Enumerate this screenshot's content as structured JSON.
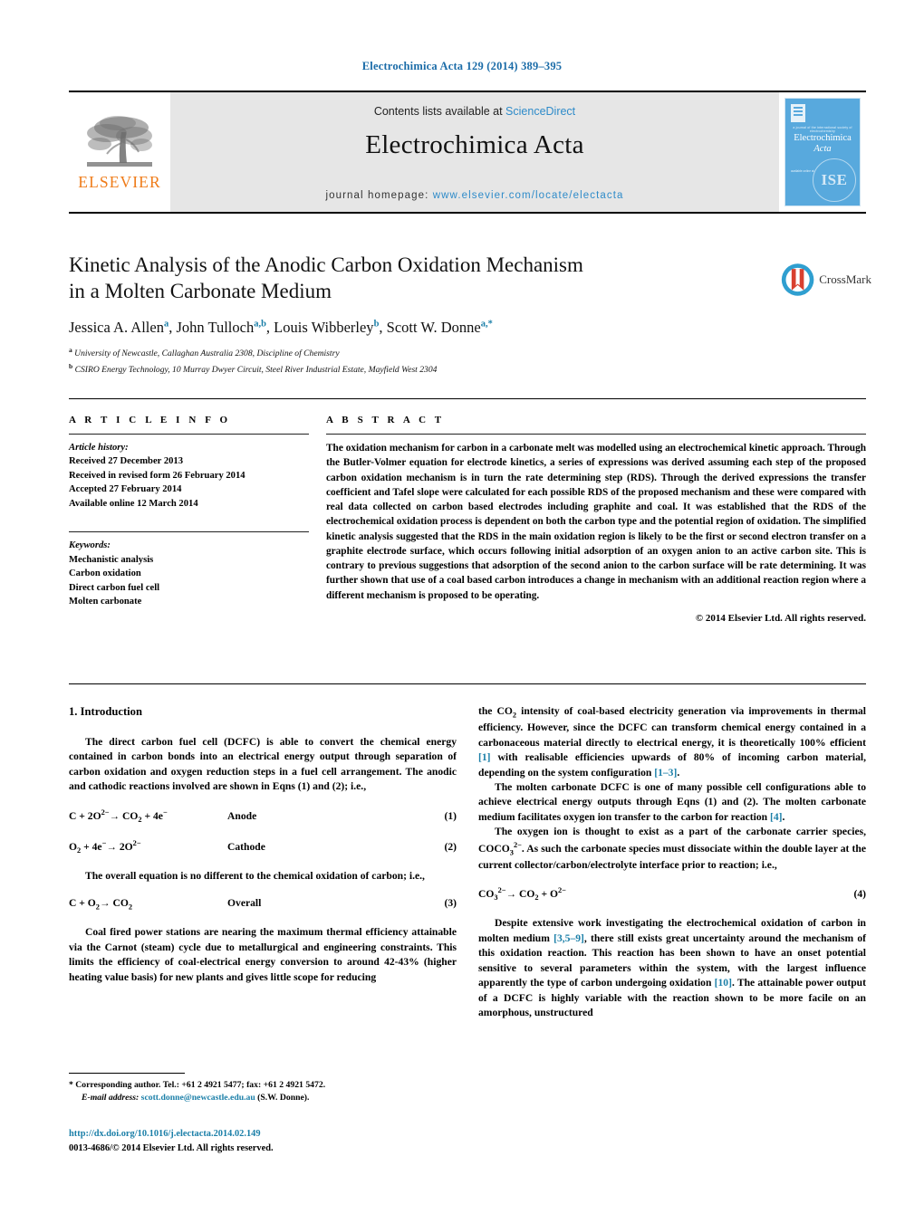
{
  "running_head": "Electrochimica Acta 129 (2014) 389–395",
  "masthead": {
    "contents_prefix": "Contents lists available at ",
    "sciencedirect": "ScienceDirect",
    "journal_name": "Electrochimica Acta",
    "homepage_prefix": "journal homepage: ",
    "homepage_url": "www.elsevier.com/locate/electacta",
    "publisher_logo_text": "ELSEVIER",
    "cover": {
      "title_line1": "Electrochimica",
      "title_line2": "Acta",
      "tagline": "a journal of the international society of electrochemistry",
      "sub_label": "available online at",
      "society_mark": "ISE"
    },
    "accent_color": "#2e8bc9",
    "elsevier_orange": "#ef7c1a"
  },
  "article": {
    "title_line1": "Kinetic Analysis of the Anodic Carbon Oxidation Mechanism",
    "title_line2": "in a Molten Carbonate Medium",
    "authors_html": "Jessica A. Allen<sup>a</sup>, John Tulloch<sup>a,b</sup>, Louis Wibberley<sup>b</sup>, Scott W. Donne<sup>a,*</sup>",
    "affiliation_a_marker": "a",
    "affiliation_a": "University of Newcastle, Callaghan Australia 2308, Discipline of Chemistry",
    "affiliation_b_marker": "b",
    "affiliation_b": "CSIRO Energy Technology, 10 Murray Dwyer Circuit, Steel River Industrial Estate, Mayfield West 2304",
    "crossmark_label": "CrossMark"
  },
  "article_info": {
    "heading": "A R T I C L E   I N F O",
    "history_label": "Article history:",
    "history": [
      "Received 27 December 2013",
      "Received in revised form 26 February 2014",
      "Accepted 27 February 2014",
      "Available online 12 March 2014"
    ],
    "keywords_label": "Keywords:",
    "keywords": [
      "Mechanistic analysis",
      "Carbon oxidation",
      "Direct carbon fuel cell",
      "Molten carbonate"
    ]
  },
  "abstract": {
    "heading": "A B S T R A C T",
    "text": "The oxidation mechanism for carbon in a carbonate melt was modelled using an electrochemical kinetic approach. Through the Butler-Volmer equation for electrode kinetics, a series of expressions was derived assuming each step of the proposed carbon oxidation mechanism is in turn the rate determining step (RDS). Through the derived expressions the transfer coefficient and Tafel slope were calculated for each possible RDS of the proposed mechanism and these were compared with real data collected on carbon based electrodes including graphite and coal. It was established that the RDS of the electrochemical oxidation process is dependent on both the carbon type and the potential region of oxidation. The simplified kinetic analysis suggested that the RDS in the main oxidation region is likely to be the first or second electron transfer on a graphite electrode surface, which occurs following initial adsorption of an oxygen anion to an active carbon site. This is contrary to previous suggestions that adsorption of the second anion to the carbon surface will be rate determining. It was further shown that use of a coal based carbon introduces a change in mechanism with an additional reaction region where a different mechanism is proposed to be operating.",
    "copyright": "© 2014 Elsevier Ltd. All rights reserved."
  },
  "body": {
    "section_heading": "1.  Introduction",
    "left": {
      "p1": "The direct carbon fuel cell (DCFC) is able to convert the chemical energy contained in carbon bonds into an electrical energy output through separation of carbon oxidation and oxygen reduction steps in a fuel cell arrangement. The anodic and cathodic reactions involved are shown in Eqns (1) and (2); i.e.,",
      "eq1_lhs": "C + 2O2− → CO2 + 4e−",
      "eq1_tag": "Anode",
      "eq1_num": "(1)",
      "eq2_lhs": "O2 + 4e− → 2O2−",
      "eq2_tag": "Cathode",
      "eq2_num": "(2)",
      "p2": "The overall equation is no different to the chemical oxidation of carbon; i.e.,",
      "eq3_lhs": "C + O2 → CO2",
      "eq3_tag": "Overall",
      "eq3_num": "(3)",
      "p3": "Coal fired power stations are nearing the maximum thermal efficiency attainable via the Carnot (steam) cycle due to metallurgical and engineering constraints. This limits the efficiency of coal-electrical energy conversion to around 42-43% (higher heating value basis) for new plants and gives little scope for reducing"
    },
    "right": {
      "p1a": "the CO",
      "p1b": " intensity of coal-based electricity generation via improvements in thermal efficiency. However, since the DCFC can transform chemical energy contained in a carbonaceous material directly to electrical energy, it is theoretically 100% efficient ",
      "p1_ref1": "[1]",
      "p1c": " with realisable efficiencies upwards of 80% of incoming carbon material, depending on the system configuration ",
      "p1_ref2": "[1–3]",
      "p1d": ".",
      "p2a": "The molten carbonate DCFC is one of many possible cell configurations able to achieve electrical energy outputs through Eqns (1) and (2). The molten carbonate medium facilitates oxygen ion transfer to the carbon for reaction ",
      "p2_ref": "[4]",
      "p2b": ".",
      "p3a": "The oxygen ion is thought to exist as a part of the carbonate carrier species, CO",
      "p3b": ". As such the carbonate species must dissociate within the double layer at the current collector/carbon/electrolyte interface prior to reaction; i.e.,",
      "eq4_lhs": "CO32− → CO2 + O2−",
      "eq4_num": "(4)",
      "p4a": "Despite extensive work investigating the electrochemical oxidation of carbon in molten medium ",
      "p4_ref1": "[3,5–9]",
      "p4b": ", there still exists great uncertainty around the mechanism of this oxidation reaction. This reaction has been shown to have an onset potential sensitive to several parameters within the system, with the largest influence apparently the type of carbon undergoing oxidation ",
      "p4_ref2": "[10]",
      "p4c": ". The attainable power output of a DCFC is highly variable with the reaction shown to be more facile on an amorphous, unstructured"
    }
  },
  "footer": {
    "corresponding_marker": "*",
    "corresponding": "Corresponding author. Tel.: +61 2 4921 5477; fax: +61 2 4921 5472.",
    "email_label": "E-mail address:",
    "email": "scott.donne@newcastle.edu.au",
    "email_suffix": "(S.W. Donne).",
    "doi_url": "http://dx.doi.org/10.1016/j.electacta.2014.02.149",
    "issn_line": "0013-4686/© 2014 Elsevier Ltd. All rights reserved."
  }
}
